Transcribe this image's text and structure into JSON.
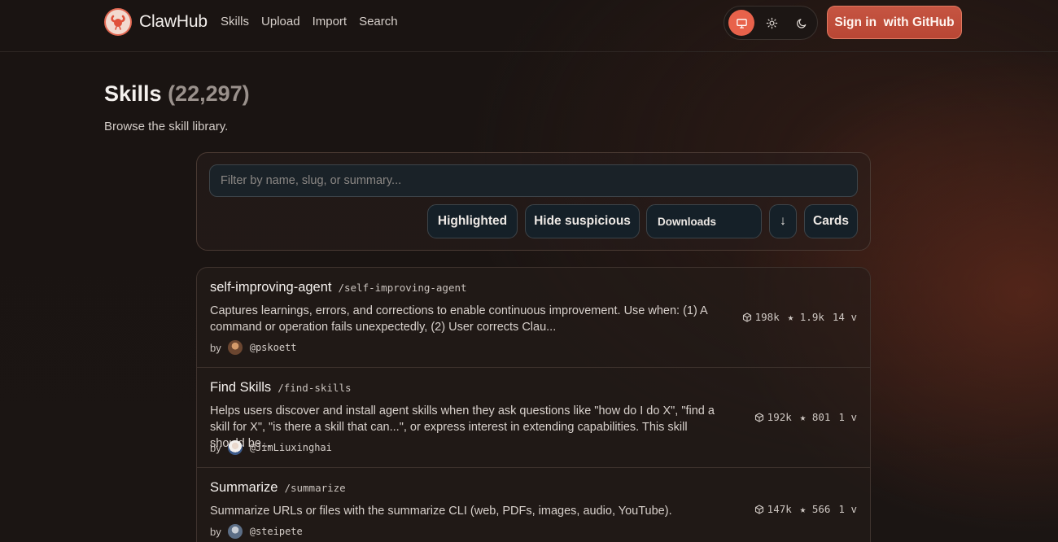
{
  "app": {
    "name": "ClawHub",
    "nav": [
      "Skills",
      "Upload",
      "Import",
      "Search"
    ],
    "signin_label": "Sign in  with GitHub"
  },
  "theme": {
    "options": [
      "system-icon",
      "sun-icon",
      "moon-icon"
    ],
    "active": "system",
    "accent": "#e8624b"
  },
  "page": {
    "title": "Skills",
    "count": "(22,297)",
    "subtitle": "Browse the skill library."
  },
  "filters": {
    "search_placeholder": "Filter by name, slug, or summary...",
    "search_value": "",
    "highlighted_label": "Highlighted",
    "hide_suspicious_label": "Hide suspicious",
    "sort_value": "Downloads",
    "sort_direction": "↓",
    "view_label": "Cards"
  },
  "skills": [
    {
      "name": "self-improving-agent",
      "slug": "/self-improving-agent",
      "summary": "Captures learnings, errors, and corrections to enable continuous improvement. Use when: (1) A command or operation fails unexpectedly, (2) User corrects Clau...",
      "by": "by",
      "author": "@pskoett",
      "downloads": "198k",
      "stars": "★ 1.9k",
      "versions": "14 v"
    },
    {
      "name": "Find Skills",
      "slug": "/find-skills",
      "summary": "Helps users discover and install agent skills when they ask questions like \"how do I do X\", \"find a skill for X\", \"is there a skill that can...\", or express interest in extending capabilities. This skill should be...",
      "by": "by",
      "author": "@JimLiuxinghai",
      "downloads": "192k",
      "stars": "★ 801",
      "versions": "1 v"
    },
    {
      "name": "Summarize",
      "slug": "/summarize",
      "summary": "Summarize URLs or files with the summarize CLI (web, PDFs, images, audio, YouTube).",
      "by": "by",
      "author": "@steipete",
      "downloads": "147k",
      "stars": "★ 566",
      "versions": "1 v"
    }
  ]
}
